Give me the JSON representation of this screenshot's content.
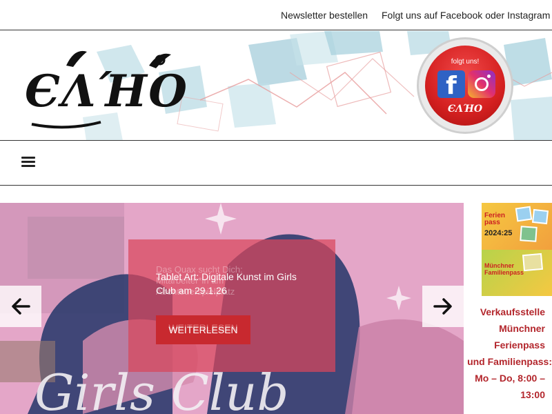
{
  "topbar": {
    "newsletter": "Newsletter bestellen",
    "social": "Folgt uns auf Facebook oder Instagram"
  },
  "header": {
    "logo_text": "ЄΛΉO",
    "badge": {
      "label": "folgt uns!",
      "facebook_letter": "f",
      "logo_text": "ЄΛΉO"
    }
  },
  "nav": {
    "menu_icon": "hamburger-menu-icon"
  },
  "slider": {
    "ghost_title": "Das Quax sucht Dich: Mitarbeiter*in am Abenteuerspielplatz",
    "title": "Tablet Art: Digitale Kunst im Girls Club am 29.1.26",
    "button_label": "WEITERLESEN",
    "ghost_button_label": "WEITERLESEN",
    "prev_icon": "arrow-left-icon",
    "next_icon": "arrow-right-icon"
  },
  "sidebar": {
    "ad": {
      "ferien": "Ferien pass",
      "year": "2024:25",
      "familien": "Münchner Familienpass"
    },
    "text_lines": [
      "Verkaufsstelle",
      "Münchner",
      "Ferienpass",
      "und Familienpass:",
      "Mo – Do, 8:00 –",
      "13:00"
    ]
  },
  "colors": {
    "accent_red": "#c8292f",
    "sidebar_text": "#b3262c",
    "slider_pink": "#e9a9cc"
  }
}
